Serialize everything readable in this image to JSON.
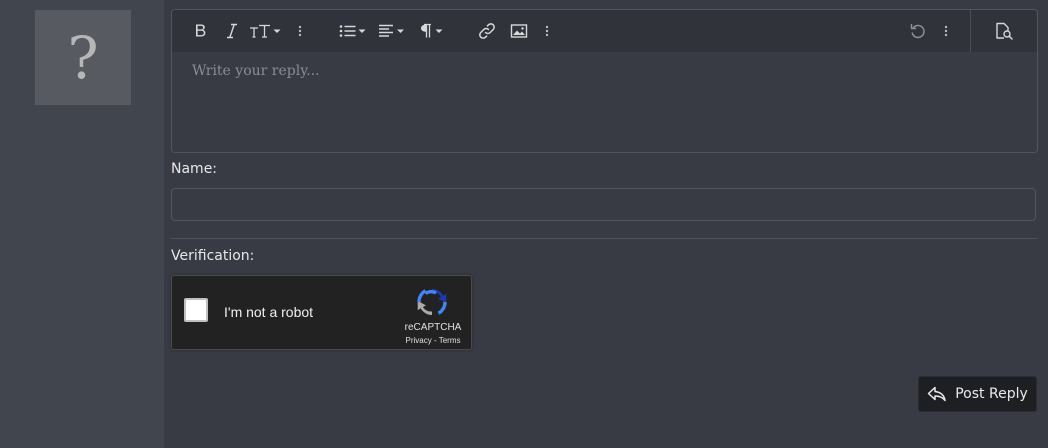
{
  "avatar": {
    "glyph": "?"
  },
  "editor": {
    "placeholder": "Write your reply...",
    "toolbar": [
      {
        "name": "bold",
        "icon": "bold-icon"
      },
      {
        "name": "italic",
        "icon": "italic-icon"
      },
      {
        "name": "font-size",
        "icon": "text-size-icon"
      },
      {
        "name": "more-text",
        "icon": "vertical-ellipsis-icon"
      },
      {
        "name": "list",
        "icon": "list-icon"
      },
      {
        "name": "align",
        "icon": "align-left-icon"
      },
      {
        "name": "paragraph",
        "icon": "pilcrow-icon"
      },
      {
        "name": "link",
        "icon": "link-icon"
      },
      {
        "name": "image",
        "icon": "image-icon"
      },
      {
        "name": "more-insert",
        "icon": "vertical-ellipsis-icon"
      },
      {
        "name": "undo",
        "icon": "undo-icon"
      },
      {
        "name": "more-options",
        "icon": "vertical-ellipsis-icon"
      },
      {
        "name": "preview",
        "icon": "preview-icon"
      }
    ]
  },
  "form": {
    "name_label": "Name:",
    "name_value": "",
    "verification_label": "Verification:"
  },
  "recaptcha": {
    "label": "I'm not a robot",
    "brand": "reCAPTCHA",
    "privacy": "Privacy",
    "separator": "-",
    "terms": "Terms",
    "checked": false
  },
  "actions": {
    "post_reply_label": "Post Reply"
  }
}
